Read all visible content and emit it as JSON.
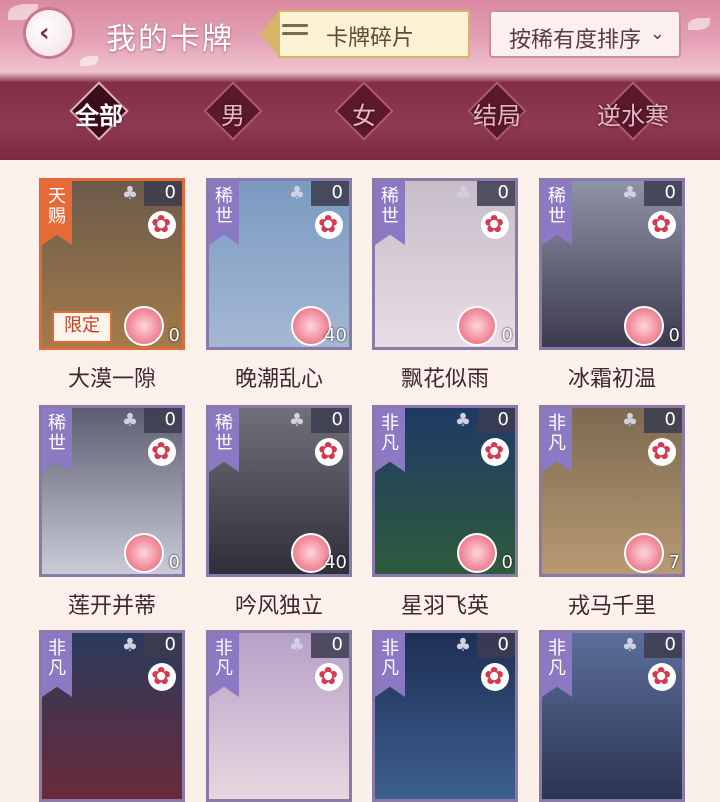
{
  "header": {
    "title": "我的卡牌",
    "fragment_button": "卡牌碎片",
    "sort_label": "按稀有度排序",
    "sort_caret": "⌄",
    "back_icon": "‹"
  },
  "tabs": [
    "全部",
    "男",
    "女",
    "结局",
    "逆水寒"
  ],
  "colors": {
    "rare": "#8b79c4",
    "special": "#e66a38",
    "accent": "#7e2b42"
  },
  "cards": [
    {
      "name": "大漠一隙",
      "rarity": "天赐",
      "count": "0",
      "level": "0",
      "limited": "限定",
      "top": "#6b5a4a",
      "bottom": "#a37b4a"
    },
    {
      "name": "晚潮乱心",
      "rarity": "稀世",
      "count": "0",
      "level": "40",
      "top": "#7a9ac0",
      "bottom": "#a4b8d4"
    },
    {
      "name": "飘花似雨",
      "rarity": "稀世",
      "count": "0",
      "level": "0",
      "top": "#c6bdc8",
      "bottom": "#e8dde6"
    },
    {
      "name": "冰霜初温",
      "rarity": "稀世",
      "count": "0",
      "level": "0",
      "top": "#8f93a8",
      "bottom": "#3c3a4e"
    },
    {
      "name": "莲开并蒂",
      "rarity": "稀世",
      "count": "0",
      "level": "0",
      "top": "#5c5d70",
      "bottom": "#c9ccd8"
    },
    {
      "name": "吟风独立",
      "rarity": "稀世",
      "count": "0",
      "level": "40",
      "top": "#6f7079",
      "bottom": "#2f2f3a"
    },
    {
      "name": "星羽飞英",
      "rarity": "非凡",
      "count": "0",
      "level": "0",
      "top": "#1f3a66",
      "bottom": "#2f5b3c"
    },
    {
      "name": "戎马千里",
      "rarity": "非凡",
      "count": "0",
      "level": "7",
      "top": "#7d6a52",
      "bottom": "#b79a72"
    },
    {
      "name": "",
      "rarity": "非凡",
      "count": "0",
      "level": "",
      "top": "#2a3b5c",
      "bottom": "#6a2a3a"
    },
    {
      "name": "",
      "rarity": "非凡",
      "count": "0",
      "level": "",
      "top": "#b6a0c6",
      "bottom": "#e8d6e0"
    },
    {
      "name": "",
      "rarity": "非凡",
      "count": "0",
      "level": "",
      "top": "#1e2f55",
      "bottom": "#3d5f8e"
    },
    {
      "name": "",
      "rarity": "非凡",
      "count": "0",
      "level": "",
      "top": "#5b6e9a",
      "bottom": "#2c3552"
    }
  ]
}
